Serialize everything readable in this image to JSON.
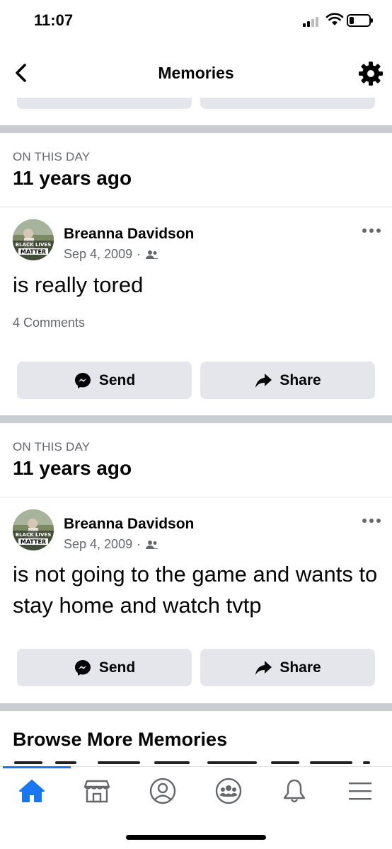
{
  "status_bar": {
    "time": "11:07"
  },
  "header": {
    "title": "Memories"
  },
  "memories": [
    {
      "kicker": "ON THIS DAY",
      "heading": "11 years ago",
      "post": {
        "author": "Breanna Davidson",
        "date": "Sep 4, 2009",
        "separator": "·",
        "text": "is really tored",
        "comments": "4 Comments",
        "avatar_text_1": "BLACK LIVES",
        "avatar_text_2": "MATTER"
      },
      "actions": {
        "send": "Send",
        "share": "Share"
      }
    },
    {
      "kicker": "ON THIS DAY",
      "heading": "11 years ago",
      "post": {
        "author": "Breanna Davidson",
        "date": "Sep 4, 2009",
        "separator": "·",
        "text": "is not going to the game and wants to stay home and watch tvtp",
        "avatar_text_1": "BLACK LIVES",
        "avatar_text_2": "MATTER"
      },
      "actions": {
        "send": "Send",
        "share": "Share"
      }
    }
  ],
  "browse": {
    "heading": "Browse More Memories"
  },
  "tabs": [
    {
      "name": "home",
      "icon": "home-icon",
      "active": true
    },
    {
      "name": "marketplace",
      "icon": "marketplace-icon",
      "active": false
    },
    {
      "name": "profile",
      "icon": "profile-icon",
      "active": false
    },
    {
      "name": "groups",
      "icon": "groups-icon",
      "active": false
    },
    {
      "name": "notifications",
      "icon": "bell-icon",
      "active": false
    },
    {
      "name": "menu",
      "icon": "menu-icon",
      "active": false
    }
  ],
  "colors": {
    "accent": "#1877f2",
    "button_bg": "#e4e6eb",
    "secondary_text": "#65676b",
    "divider": "#c9ccd1"
  }
}
